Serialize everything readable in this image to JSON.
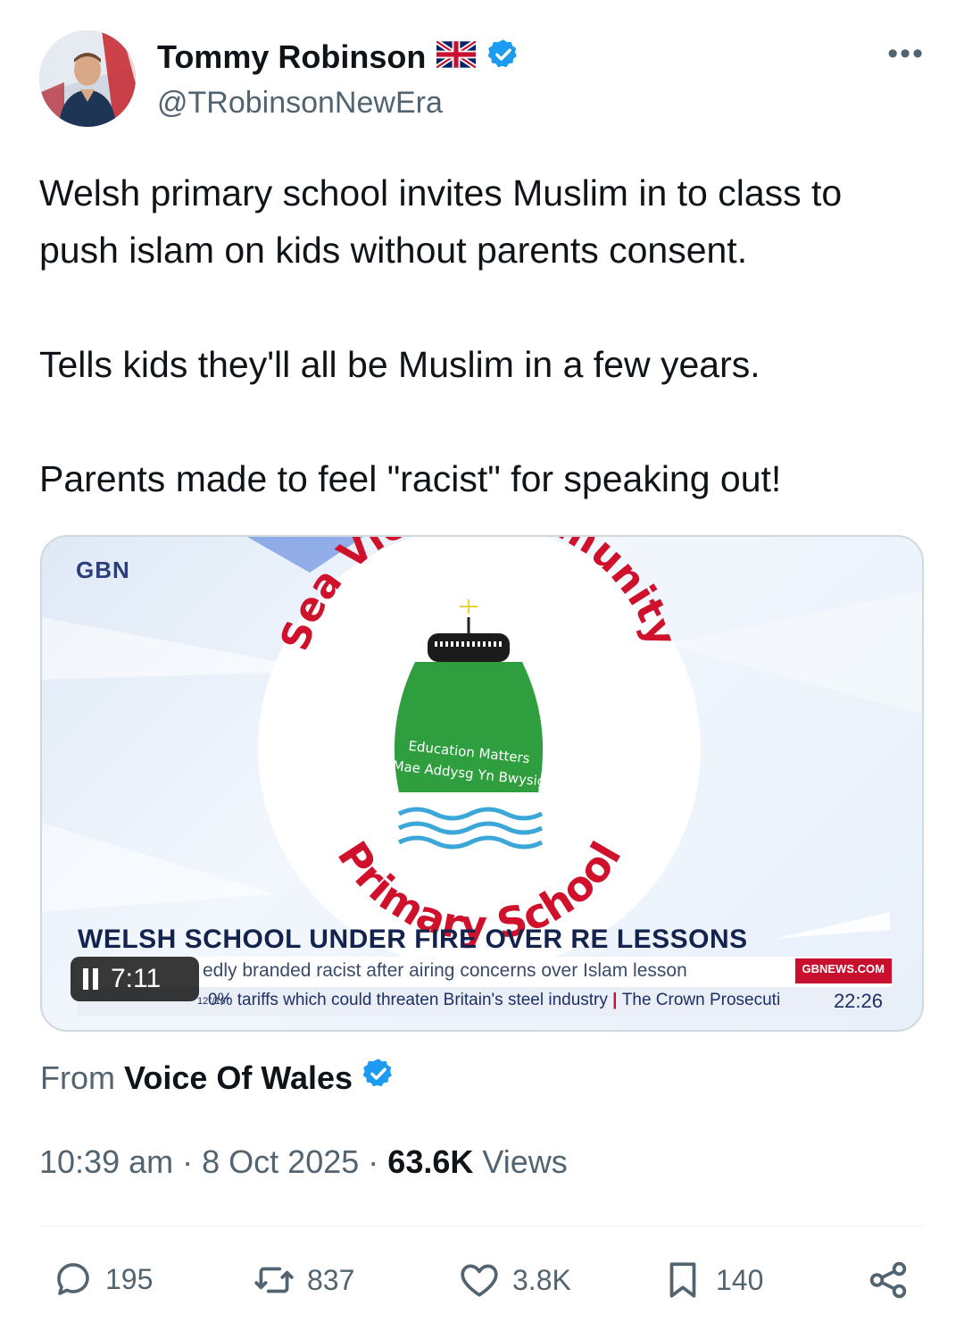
{
  "author": {
    "name": "Tommy Robinson",
    "flag_emoji": "🇬🇧",
    "verified": true,
    "handle": "@TRobinsonNewEra"
  },
  "more_menu": "•••",
  "tweet": {
    "paragraphs": [
      "Welsh primary school invites Muslim in to class to push islam on kids without parents consent.",
      "Tells kids they'll all be Muslim in a few years.",
      "Parents made to feel \"racist\" for speaking out!"
    ]
  },
  "media": {
    "channel_logo": "GBN",
    "logo_top_text": "Sea View Community",
    "logo_bottom_text": "Primary School",
    "logo_motto_1": "Education Matters",
    "logo_motto_2": "Mae Addysg Yn Bwysig",
    "headline": "WELSH SCHOOL UNDER FIRE OVER RE LESSONS",
    "ticker_1": "edly branded racist after airing concerns over Islam lesson",
    "ticker_badge": "GBNEWS.COM",
    "ticker_2_a": "0% tariffs which could threaten Britain's steel industry",
    "ticker_2_b": "The Crown Prosecuti",
    "ticker_date": "12°/16°",
    "clock": "22:26",
    "duration": "7:11"
  },
  "source": {
    "prefix": "From",
    "name": "Voice Of Wales",
    "verified": true
  },
  "meta": {
    "time": "10:39 am",
    "date": "8 Oct 2025",
    "views_count": "63.6K",
    "views_label": "Views",
    "separator": "·"
  },
  "actions": {
    "replies": "195",
    "reposts": "837",
    "likes": "3.8K",
    "bookmarks": "140"
  },
  "colors": {
    "verified_blue": "#1d9bf0",
    "text_primary": "#0f1419",
    "text_secondary": "#536471",
    "logo_red": "#d0112b",
    "logo_green": "#2e9e3e"
  }
}
